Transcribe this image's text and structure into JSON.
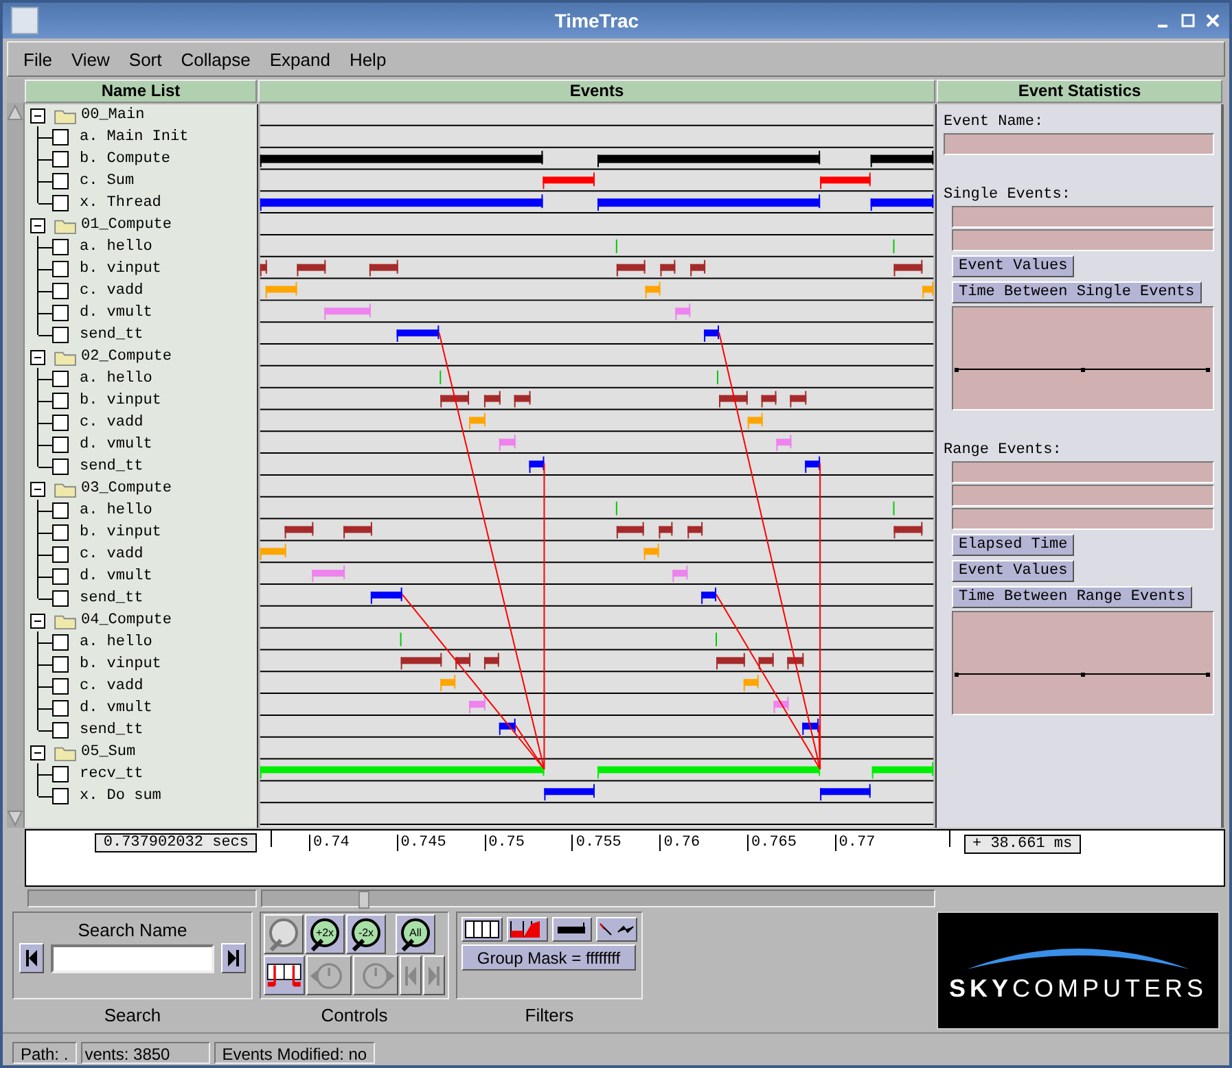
{
  "window": {
    "title": "TimeTrac"
  },
  "menu": [
    "File",
    "View",
    "Sort",
    "Collapse",
    "Expand",
    "Help"
  ],
  "name_list": {
    "title": "Name List",
    "groups": [
      {
        "name": "00_Main",
        "expanded": true,
        "children": [
          {
            "name": "a. Main Init",
            "checked": false
          },
          {
            "name": "b. Compute",
            "checked": false
          },
          {
            "name": "c. Sum",
            "checked": false
          },
          {
            "name": "x. Thread",
            "checked": false
          }
        ]
      },
      {
        "name": "01_Compute",
        "expanded": true,
        "children": [
          {
            "name": "a. hello",
            "checked": false
          },
          {
            "name": "b. vinput",
            "checked": false
          },
          {
            "name": "c. vadd",
            "checked": false
          },
          {
            "name": "d. vmult",
            "checked": false
          },
          {
            "name": "send_tt",
            "checked": false
          }
        ]
      },
      {
        "name": "02_Compute",
        "expanded": true,
        "children": [
          {
            "name": "a. hello",
            "checked": false
          },
          {
            "name": "b. vinput",
            "checked": false
          },
          {
            "name": "c. vadd",
            "checked": false
          },
          {
            "name": "d. vmult",
            "checked": false
          },
          {
            "name": "send_tt",
            "checked": false
          }
        ]
      },
      {
        "name": "03_Compute",
        "expanded": true,
        "children": [
          {
            "name": "a. hello",
            "checked": false
          },
          {
            "name": "b. vinput",
            "checked": false
          },
          {
            "name": "c. vadd",
            "checked": false
          },
          {
            "name": "d. vmult",
            "checked": false
          },
          {
            "name": "send_tt",
            "checked": false
          }
        ]
      },
      {
        "name": "04_Compute",
        "expanded": true,
        "children": [
          {
            "name": "a. hello",
            "checked": false
          },
          {
            "name": "b. vinput",
            "checked": false
          },
          {
            "name": "c. vadd",
            "checked": false
          },
          {
            "name": "d. vmult",
            "checked": false
          },
          {
            "name": "send_tt",
            "checked": false
          }
        ]
      },
      {
        "name": "05_Sum",
        "expanded": true,
        "children": [
          {
            "name": "recv_tt",
            "checked": false
          },
          {
            "name": "x. Do sum",
            "checked": false
          }
        ]
      }
    ]
  },
  "events": {
    "title": "Events",
    "start_time": "0.737902032 secs",
    "ticks": [
      "0.74",
      "0.745",
      "0.75",
      "0.755",
      "0.76",
      "0.765",
      "0.77"
    ],
    "span": "+ 38.661 ms"
  },
  "statistics": {
    "title": "Event Statistics",
    "sections": [
      {
        "kind": "name",
        "label": "Event Name:"
      },
      {
        "kind": "single",
        "label": "Single Events:",
        "buttons": [
          "Event Values",
          "Time Between Single Events"
        ]
      },
      {
        "kind": "range",
        "label": "Range Events:",
        "buttons": [
          "Elapsed Time",
          "Event Values",
          "Time Between Range Events"
        ]
      }
    ]
  },
  "search": {
    "title": "Search Name",
    "label": "Search"
  },
  "controls": {
    "label": "Controls",
    "rows": [
      [
        {
          "kind": "zoom-box",
          "disabled": true
        },
        {
          "kind": "zoom",
          "text": "+2x",
          "disabled": false
        },
        {
          "kind": "zoom",
          "text": "-2x",
          "disabled": false
        },
        {
          "kind": "zoom",
          "text": "All",
          "disabled": false
        }
      ],
      [
        {
          "kind": "markers",
          "disabled": false
        },
        {
          "kind": "clock-back",
          "disabled": true
        },
        {
          "kind": "clock-forward",
          "disabled": true
        },
        {
          "kind": "prev",
          "disabled": true
        },
        {
          "kind": "next",
          "disabled": true
        }
      ]
    ]
  },
  "filters": {
    "label": "Filters",
    "buttons": [
      {
        "kind": "grid"
      },
      {
        "kind": "histogram"
      },
      {
        "kind": "bar"
      },
      {
        "kind": "lines"
      }
    ],
    "group_mask": "Group Mask = ffffffff"
  },
  "logo": "**SKY**COMPUTERS",
  "status_bar": [
    "Path: .",
    "vents: 3850",
    "Events Modified: no"
  ]
}
